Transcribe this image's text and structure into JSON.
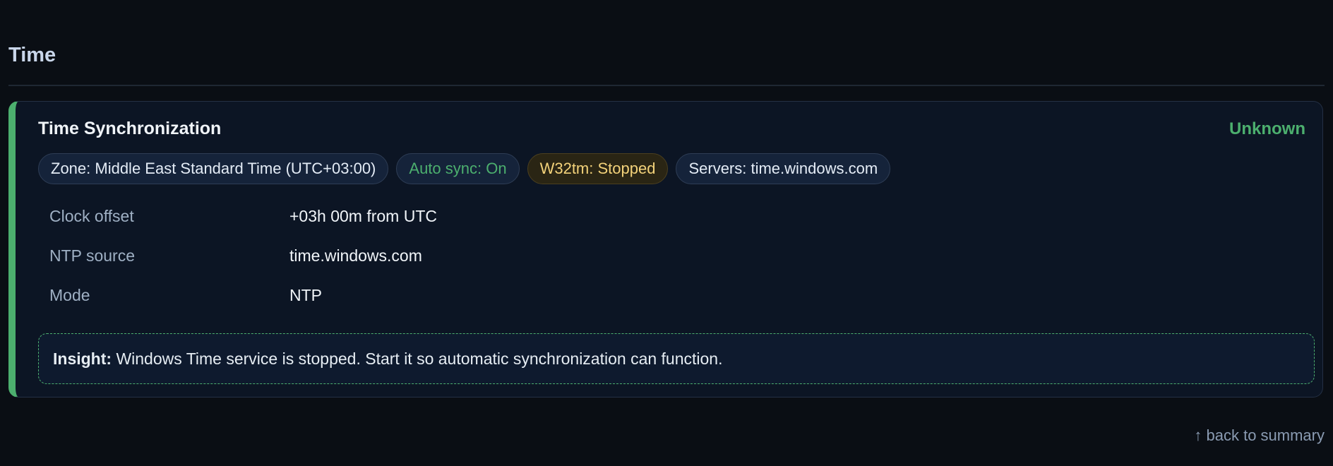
{
  "section": {
    "title": "Time"
  },
  "card": {
    "title": "Time Synchronization",
    "status": "Unknown",
    "accent_color": "#4caf6e",
    "chips": [
      {
        "label": "Zone: Middle East Standard Time (UTC+03:00)",
        "tone": "neutral"
      },
      {
        "label": "Auto sync: On",
        "tone": "ok"
      },
      {
        "label": "W32tm: Stopped",
        "tone": "warn"
      },
      {
        "label": "Servers: time.windows.com",
        "tone": "neutral"
      }
    ],
    "rows": [
      {
        "key": "Clock offset",
        "value": "+03h 00m from UTC"
      },
      {
        "key": "NTP source",
        "value": "time.windows.com"
      },
      {
        "key": "Mode",
        "value": "NTP"
      }
    ],
    "insight": {
      "label": "Insight:",
      "text": "Windows Time service is stopped. Start it so automatic synchronization can function."
    }
  },
  "footer": {
    "back_link": "↑ back to summary"
  }
}
